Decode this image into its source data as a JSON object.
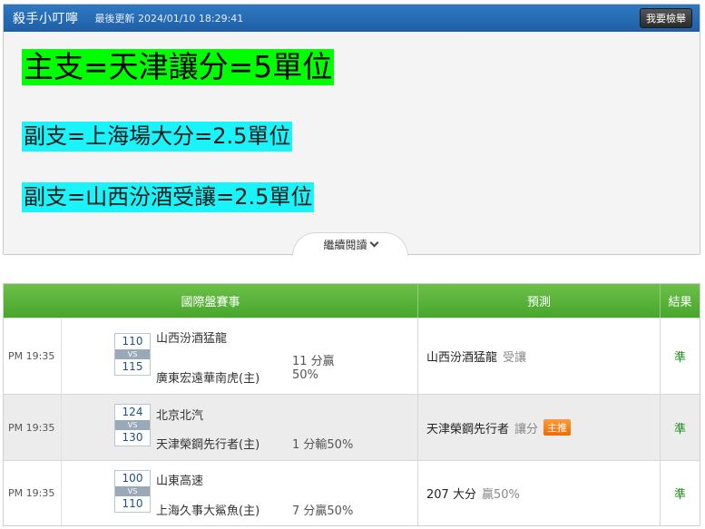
{
  "header": {
    "title": "殺手小叮嚀",
    "updated": "最後更新 2024/01/10 18:29:41",
    "buy_label": "我要檢舉"
  },
  "picks": {
    "main": "主支=天津讓分=5單位",
    "sub1": "副支=上海場大分=2.5單位",
    "sub2": "副支=山西汾酒受讓=2.5單位"
  },
  "read_more": "繼續閱讀",
  "table": {
    "headers": {
      "game": "國際盤賽事",
      "prediction": "預測",
      "result": "結果"
    },
    "rows": [
      {
        "time": "PM 19:35",
        "score_away": "110",
        "vs": "VS",
        "score_home": "115",
        "team_away": "山西汾酒猛龍",
        "team_home": "廣東宏遠華南虎(主)",
        "result_line1": "11 分贏",
        "result_line2": "50%",
        "prediction_main": "山西汾酒猛龍",
        "prediction_soft": "受讓",
        "prediction_badge": "",
        "outcome": "準"
      },
      {
        "time": "PM 19:35",
        "score_away": "124",
        "vs": "VS",
        "score_home": "130",
        "team_away": "北京北汽",
        "team_home": "天津榮鋼先行者(主)",
        "result_line1": "1 分輸50%",
        "result_line2": "",
        "prediction_main": "天津榮鋼先行者",
        "prediction_soft": "讓分",
        "prediction_badge": "主推",
        "outcome": "準"
      },
      {
        "time": "PM 19:35",
        "score_away": "100",
        "vs": "VS",
        "score_home": "110",
        "team_away": "山東高速",
        "team_home": "上海久事大鯊魚(主)",
        "result_line1": "7 分贏50%",
        "result_line2": "",
        "prediction_main": "207 大分",
        "prediction_soft": "贏50%",
        "prediction_badge": "",
        "outcome": "準"
      }
    ]
  }
}
